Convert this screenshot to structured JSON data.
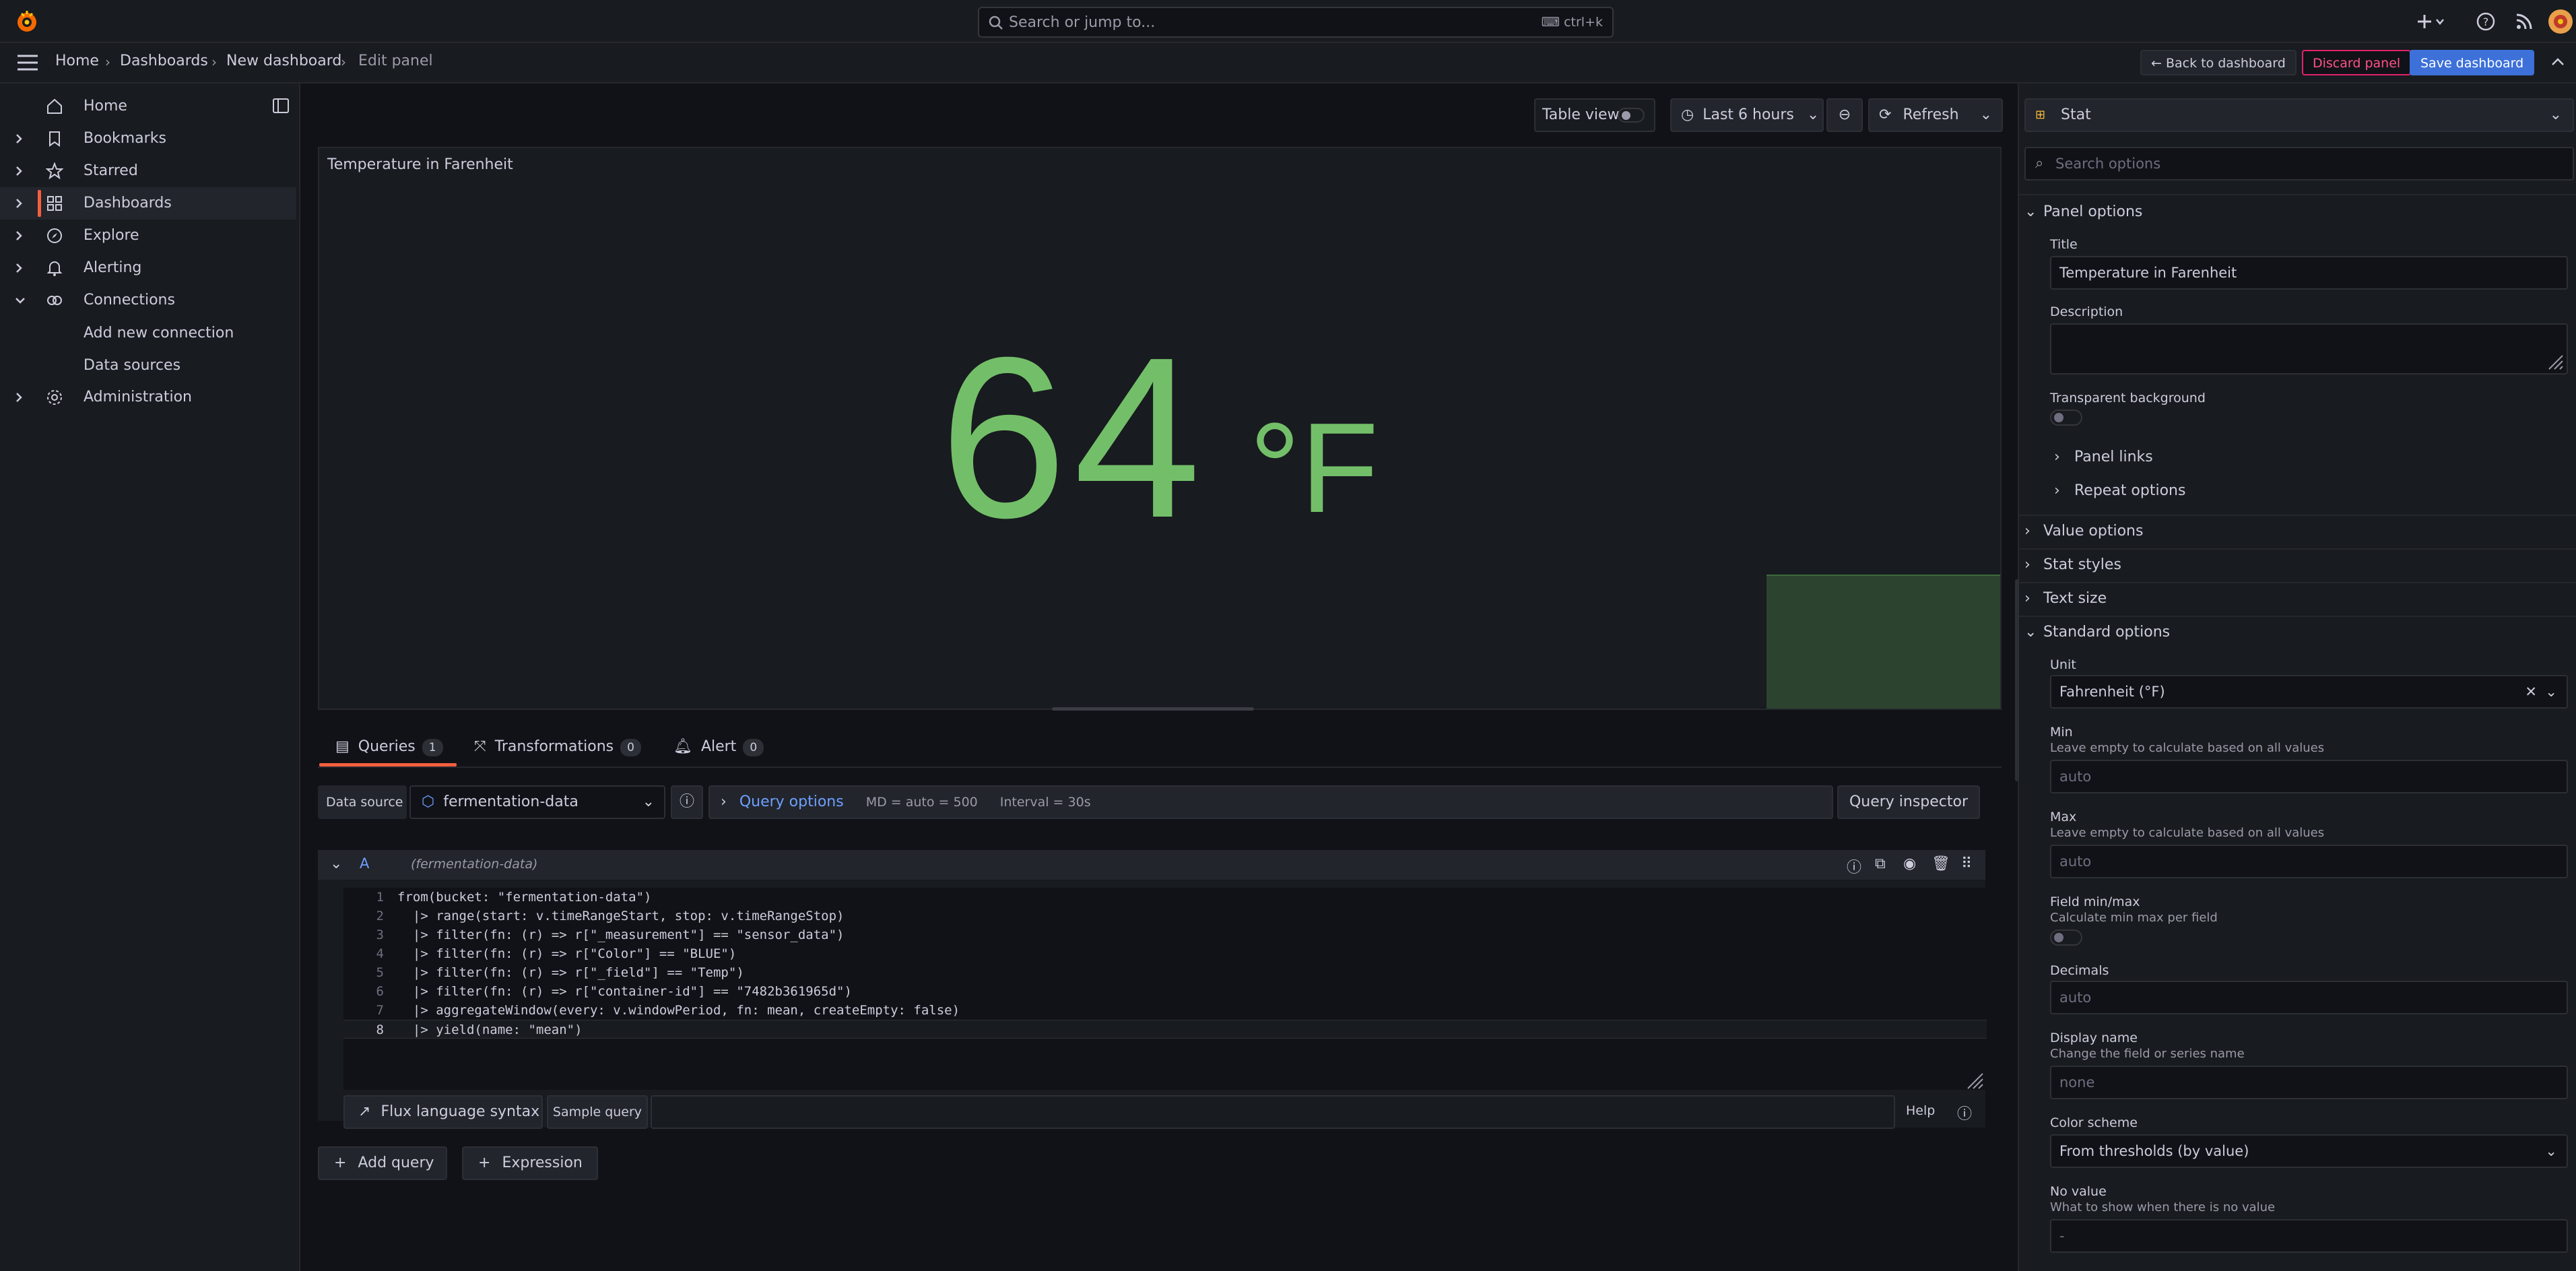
{
  "topbar": {
    "search_placeholder": "Search or jump to...",
    "search_shortcut": "ctrl+k"
  },
  "breadcrumb": {
    "items": [
      "Home",
      "Dashboards",
      "New dashboard"
    ],
    "current": "Edit panel"
  },
  "header_actions": {
    "back": "Back to dashboard",
    "discard": "Discard panel",
    "save": "Save dashboard"
  },
  "sidebar": {
    "items": [
      {
        "label": "Home",
        "icon": "home-icon"
      },
      {
        "label": "Bookmarks",
        "icon": "bookmark-icon"
      },
      {
        "label": "Starred",
        "icon": "star-icon"
      },
      {
        "label": "Dashboards",
        "icon": "dashboards-icon"
      },
      {
        "label": "Explore",
        "icon": "compass-icon"
      },
      {
        "label": "Alerting",
        "icon": "bell-icon"
      },
      {
        "label": "Connections",
        "icon": "connections-icon"
      },
      {
        "label": "Administration",
        "icon": "gear-icon"
      }
    ],
    "sub_items": [
      "Add new connection",
      "Data sources"
    ]
  },
  "panel_toolbar": {
    "table_view": "Table view",
    "time_range": "Last 6 hours",
    "refresh": "Refresh"
  },
  "panel": {
    "title": "Temperature in Farenheit",
    "value": "64",
    "unit": "°F"
  },
  "tabs": [
    {
      "label": "Queries",
      "count": "1"
    },
    {
      "label": "Transformations",
      "count": "0"
    },
    {
      "label": "Alert",
      "count": "0"
    }
  ],
  "query_row": {
    "data_source_label": "Data source",
    "data_source": "fermentation-data",
    "query_options": "Query options",
    "md": "MD = auto = 500",
    "interval": "Interval = 30s",
    "inspector": "Query inspector"
  },
  "query": {
    "ref": "A",
    "source": "(fermentation-data)",
    "lines": [
      "from(bucket: \"fermentation-data\")",
      "  |> range(start: v.timeRangeStart, stop: v.timeRangeStop)",
      "  |> filter(fn: (r) => r[\"_measurement\"] == \"sensor_data\")",
      "  |> filter(fn: (r) => r[\"Color\"] == \"BLUE\")",
      "  |> filter(fn: (r) => r[\"_field\"] == \"Temp\")",
      "  |> filter(fn: (r) => r[\"container-id\"] == \"7482b361965d\")",
      "  |> aggregateWindow(every: v.windowPeriod, fn: mean, createEmpty: false)",
      "  |> yield(name: \"mean\")"
    ],
    "flux_syntax": "Flux language syntax",
    "sample_query": "Sample query",
    "help": "Help"
  },
  "add_buttons": {
    "add_query": "Add query",
    "expression": "Expression"
  },
  "options": {
    "viz_type": "Stat",
    "search_placeholder": "Search options",
    "panel_options": "Panel options",
    "title_label": "Title",
    "title_value": "Temperature in Farenheit",
    "description_label": "Description",
    "transparent_label": "Transparent background",
    "panel_links": "Panel links",
    "repeat_options": "Repeat options",
    "value_options": "Value options",
    "stat_styles": "Stat styles",
    "text_size": "Text size",
    "standard_options": "Standard options",
    "unit_label": "Unit",
    "unit_value": "Fahrenheit (°F)",
    "min_label": "Min",
    "min_desc": "Leave empty to calculate based on all values",
    "min_placeholder": "auto",
    "max_label": "Max",
    "max_desc": "Leave empty to calculate based on all values",
    "max_placeholder": "auto",
    "field_minmax_label": "Field min/max",
    "field_minmax_desc": "Calculate min max per field",
    "decimals_label": "Decimals",
    "decimals_placeholder": "auto",
    "display_name_label": "Display name",
    "display_name_desc": "Change the field or series name",
    "display_name_placeholder": "none",
    "color_scheme_label": "Color scheme",
    "color_scheme_value": "From thresholds (by value)",
    "no_value_label": "No value",
    "no_value_desc": "What to show when there is no value",
    "no_value_placeholder": "-"
  },
  "colors": {
    "accent": "#f55f3e",
    "stat_green": "#73bf69",
    "primary_blue": "#3d71d9",
    "discard_red": "#e0226e"
  }
}
